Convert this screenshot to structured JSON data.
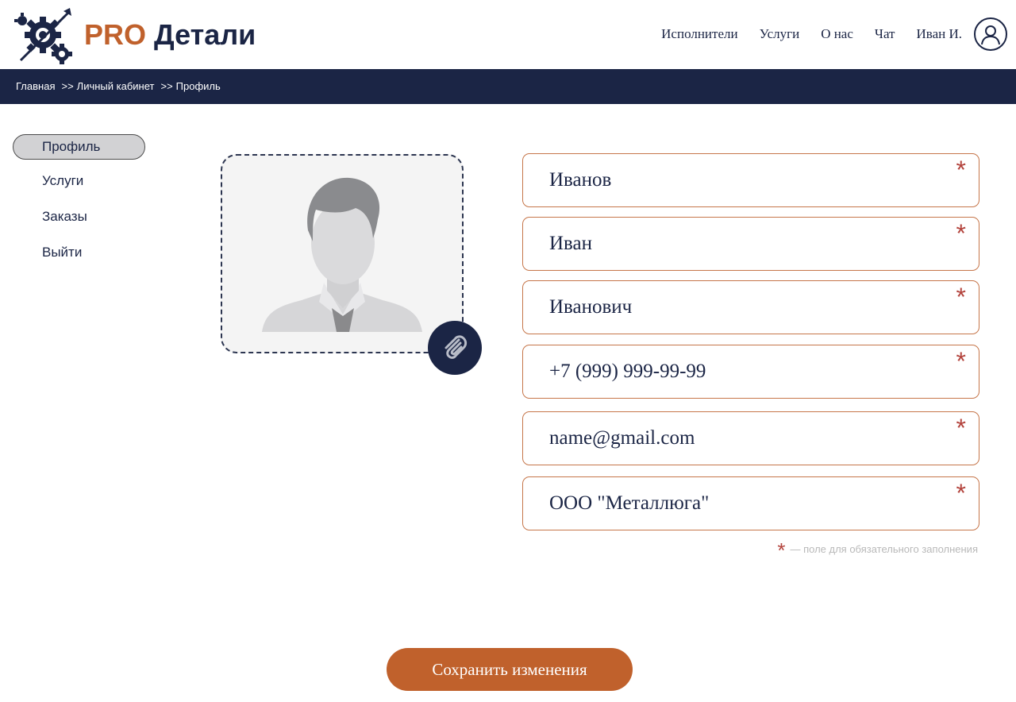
{
  "brand": {
    "pro": "PRO",
    "name": "Детали"
  },
  "nav": {
    "items": [
      "Исполнители",
      "Услуги",
      "О нас",
      "Чат"
    ],
    "user": "Иван И."
  },
  "breadcrumb": {
    "items": [
      "Главная",
      "Личный кабинет",
      "Профиль"
    ],
    "separator": ">>"
  },
  "sidebar": {
    "items": [
      {
        "label": "Профиль",
        "active": true
      },
      {
        "label": "Услуги",
        "active": false
      },
      {
        "label": "Заказы",
        "active": false
      },
      {
        "label": "Выйти",
        "active": false
      }
    ]
  },
  "profile": {
    "photo": "user-placeholder-silhouette",
    "attach_icon": "paperclip-icon"
  },
  "form": {
    "fields": [
      {
        "value": "Иванов",
        "required_mark": "*"
      },
      {
        "value": "Иван",
        "required_mark": "*"
      },
      {
        "value": "Иванович",
        "required_mark": "*"
      },
      {
        "value": "+7 (999) 999-99-99",
        "required_mark": "*"
      },
      {
        "value": "name@gmail.com",
        "required_mark": "*"
      },
      {
        "value": "ООО \"Металлюга\"",
        "required_mark": "*"
      }
    ],
    "required_note_star": "*",
    "required_note": "— поле для обязательного заполнения",
    "save_label": "Сохранить изменения"
  },
  "colors": {
    "navy": "#1b2545",
    "accent": "#c0612c",
    "field_border": "#c6764a",
    "required": "#b3433c"
  }
}
